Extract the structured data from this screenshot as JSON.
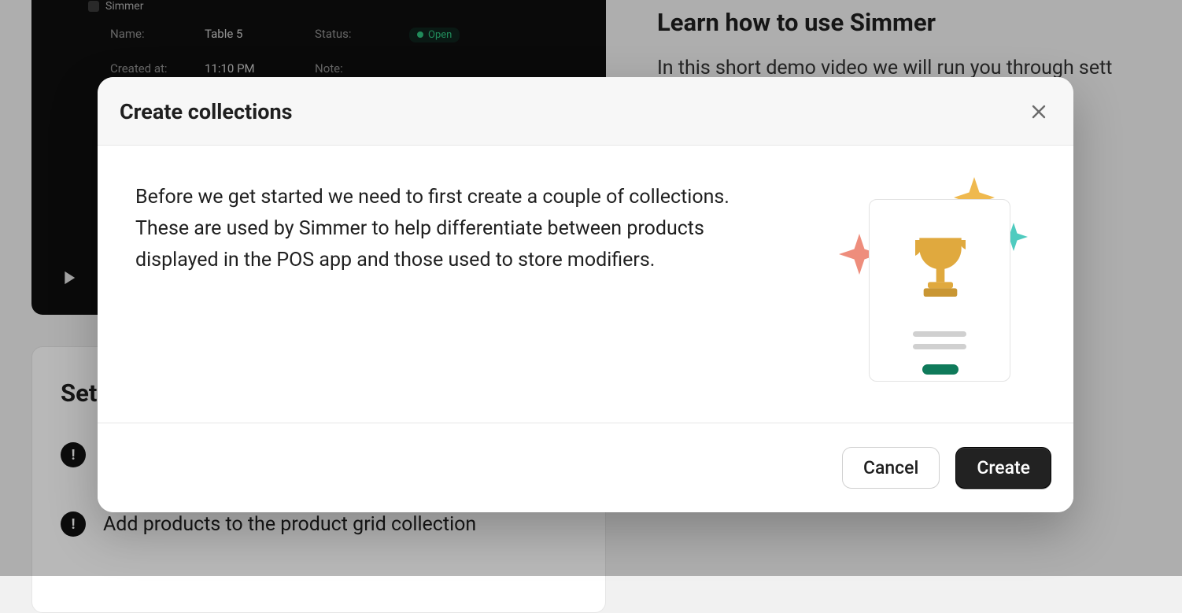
{
  "preview": {
    "app_name": "Simmer",
    "name_label": "Name:",
    "name_value": "Table 5",
    "status_label": "Status:",
    "status_value": "Open",
    "created_label": "Created at:",
    "created_value": "11:10 PM",
    "note_label": "Note:"
  },
  "learn": {
    "title": "Learn how to use Simmer",
    "body": "In this short demo video we will run you through sett"
  },
  "setup": {
    "title": "Set",
    "item_hidden": "",
    "item_add": "Add products to the product grid collection"
  },
  "modal": {
    "title": "Create collections",
    "body": "Before we get started we need to first create a couple of collections. These are used by Simmer to help differentiate between products displayed in the POS app and those used to store modifiers.",
    "cancel": "Cancel",
    "create": "Create"
  }
}
